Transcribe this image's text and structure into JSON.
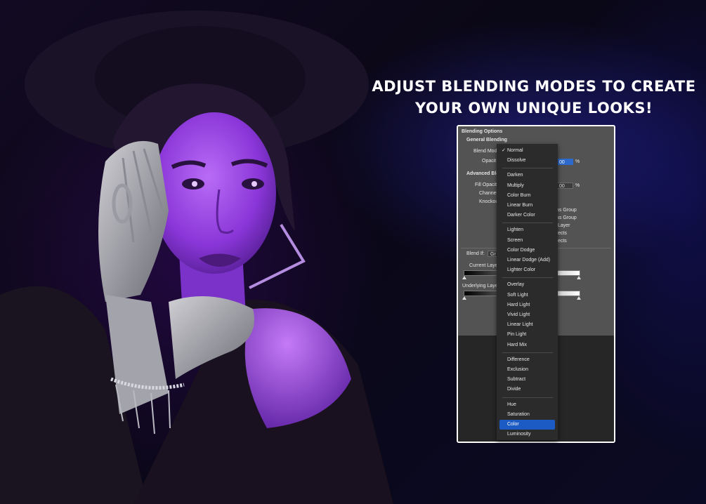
{
  "headline": {
    "line1": "ADJUST BLENDING MODES TO CREATE",
    "line2": "YOUR OWN UNIQUE LOOKS!"
  },
  "panel": {
    "title": "Blending Options",
    "general_blending": "General Blending",
    "blend_mode_label": "Blend Mod",
    "opacity_label": "Opacit",
    "opacity_value": "00",
    "percent": "%",
    "advanced_blending": "Advanced Ble",
    "fill_opacity_label": "Fill Opacit",
    "fill_opacity_value": "00",
    "channels_label": "Channel",
    "knockout_label": "Knockou",
    "options": [
      "as Group",
      "as Group",
      "Layer",
      "ects",
      "fects"
    ],
    "blend_if_label": "Blend If:",
    "blend_if_value": "Gr",
    "current_layer_label": "Current Laye",
    "underlying_layer_label": "Underlying Laye"
  },
  "menu": {
    "checkmark": "✓",
    "selected": "Normal",
    "highlighted": "Color",
    "groups": [
      [
        "Normal",
        "Dissolve"
      ],
      [
        "Darken",
        "Multiply",
        "Color Burn",
        "Linear Burn",
        "Darker Color"
      ],
      [
        "Lighten",
        "Screen",
        "Color Dodge",
        "Linear Dodge (Add)",
        "Lighter Color"
      ],
      [
        "Overlay",
        "Soft Light",
        "Hard Light",
        "Vivid Light",
        "Linear Light",
        "Pin Light",
        "Hard Mix"
      ],
      [
        "Difference",
        "Exclusion",
        "Subtract",
        "Divide"
      ],
      [
        "Hue",
        "Saturation",
        "Color",
        "Luminosity"
      ]
    ]
  },
  "colors": {
    "accent": "#9b3cf0",
    "highlight": "#1c5bc4"
  }
}
